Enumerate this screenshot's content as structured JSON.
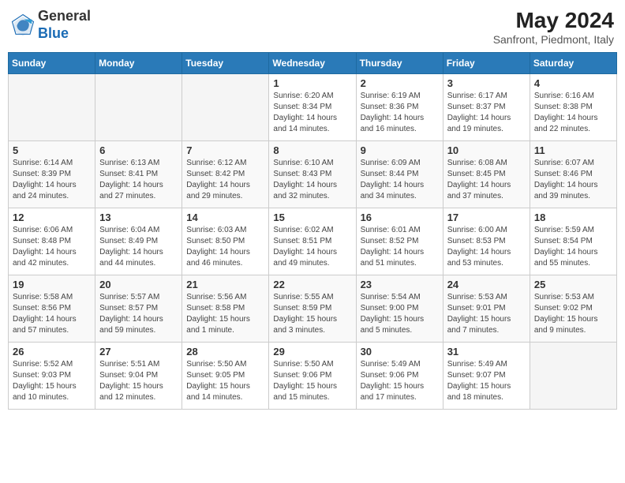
{
  "header": {
    "logo_general": "General",
    "logo_blue": "Blue",
    "month_year": "May 2024",
    "location": "Sanfront, Piedmont, Italy"
  },
  "days_of_week": [
    "Sunday",
    "Monday",
    "Tuesday",
    "Wednesday",
    "Thursday",
    "Friday",
    "Saturday"
  ],
  "weeks": [
    [
      {
        "day": "",
        "sunrise": "",
        "sunset": "",
        "daylight": ""
      },
      {
        "day": "",
        "sunrise": "",
        "sunset": "",
        "daylight": ""
      },
      {
        "day": "",
        "sunrise": "",
        "sunset": "",
        "daylight": ""
      },
      {
        "day": "1",
        "sunrise": "6:20 AM",
        "sunset": "8:34 PM",
        "daylight": "14 hours and 14 minutes."
      },
      {
        "day": "2",
        "sunrise": "6:19 AM",
        "sunset": "8:36 PM",
        "daylight": "14 hours and 16 minutes."
      },
      {
        "day": "3",
        "sunrise": "6:17 AM",
        "sunset": "8:37 PM",
        "daylight": "14 hours and 19 minutes."
      },
      {
        "day": "4",
        "sunrise": "6:16 AM",
        "sunset": "8:38 PM",
        "daylight": "14 hours and 22 minutes."
      }
    ],
    [
      {
        "day": "5",
        "sunrise": "6:14 AM",
        "sunset": "8:39 PM",
        "daylight": "14 hours and 24 minutes."
      },
      {
        "day": "6",
        "sunrise": "6:13 AM",
        "sunset": "8:41 PM",
        "daylight": "14 hours and 27 minutes."
      },
      {
        "day": "7",
        "sunrise": "6:12 AM",
        "sunset": "8:42 PM",
        "daylight": "14 hours and 29 minutes."
      },
      {
        "day": "8",
        "sunrise": "6:10 AM",
        "sunset": "8:43 PM",
        "daylight": "14 hours and 32 minutes."
      },
      {
        "day": "9",
        "sunrise": "6:09 AM",
        "sunset": "8:44 PM",
        "daylight": "14 hours and 34 minutes."
      },
      {
        "day": "10",
        "sunrise": "6:08 AM",
        "sunset": "8:45 PM",
        "daylight": "14 hours and 37 minutes."
      },
      {
        "day": "11",
        "sunrise": "6:07 AM",
        "sunset": "8:46 PM",
        "daylight": "14 hours and 39 minutes."
      }
    ],
    [
      {
        "day": "12",
        "sunrise": "6:06 AM",
        "sunset": "8:48 PM",
        "daylight": "14 hours and 42 minutes."
      },
      {
        "day": "13",
        "sunrise": "6:04 AM",
        "sunset": "8:49 PM",
        "daylight": "14 hours and 44 minutes."
      },
      {
        "day": "14",
        "sunrise": "6:03 AM",
        "sunset": "8:50 PM",
        "daylight": "14 hours and 46 minutes."
      },
      {
        "day": "15",
        "sunrise": "6:02 AM",
        "sunset": "8:51 PM",
        "daylight": "14 hours and 49 minutes."
      },
      {
        "day": "16",
        "sunrise": "6:01 AM",
        "sunset": "8:52 PM",
        "daylight": "14 hours and 51 minutes."
      },
      {
        "day": "17",
        "sunrise": "6:00 AM",
        "sunset": "8:53 PM",
        "daylight": "14 hours and 53 minutes."
      },
      {
        "day": "18",
        "sunrise": "5:59 AM",
        "sunset": "8:54 PM",
        "daylight": "14 hours and 55 minutes."
      }
    ],
    [
      {
        "day": "19",
        "sunrise": "5:58 AM",
        "sunset": "8:56 PM",
        "daylight": "14 hours and 57 minutes."
      },
      {
        "day": "20",
        "sunrise": "5:57 AM",
        "sunset": "8:57 PM",
        "daylight": "14 hours and 59 minutes."
      },
      {
        "day": "21",
        "sunrise": "5:56 AM",
        "sunset": "8:58 PM",
        "daylight": "15 hours and 1 minute."
      },
      {
        "day": "22",
        "sunrise": "5:55 AM",
        "sunset": "8:59 PM",
        "daylight": "15 hours and 3 minutes."
      },
      {
        "day": "23",
        "sunrise": "5:54 AM",
        "sunset": "9:00 PM",
        "daylight": "15 hours and 5 minutes."
      },
      {
        "day": "24",
        "sunrise": "5:53 AM",
        "sunset": "9:01 PM",
        "daylight": "15 hours and 7 minutes."
      },
      {
        "day": "25",
        "sunrise": "5:53 AM",
        "sunset": "9:02 PM",
        "daylight": "15 hours and 9 minutes."
      }
    ],
    [
      {
        "day": "26",
        "sunrise": "5:52 AM",
        "sunset": "9:03 PM",
        "daylight": "15 hours and 10 minutes."
      },
      {
        "day": "27",
        "sunrise": "5:51 AM",
        "sunset": "9:04 PM",
        "daylight": "15 hours and 12 minutes."
      },
      {
        "day": "28",
        "sunrise": "5:50 AM",
        "sunset": "9:05 PM",
        "daylight": "15 hours and 14 minutes."
      },
      {
        "day": "29",
        "sunrise": "5:50 AM",
        "sunset": "9:06 PM",
        "daylight": "15 hours and 15 minutes."
      },
      {
        "day": "30",
        "sunrise": "5:49 AM",
        "sunset": "9:06 PM",
        "daylight": "15 hours and 17 minutes."
      },
      {
        "day": "31",
        "sunrise": "5:49 AM",
        "sunset": "9:07 PM",
        "daylight": "15 hours and 18 minutes."
      },
      {
        "day": "",
        "sunrise": "",
        "sunset": "",
        "daylight": ""
      }
    ]
  ]
}
